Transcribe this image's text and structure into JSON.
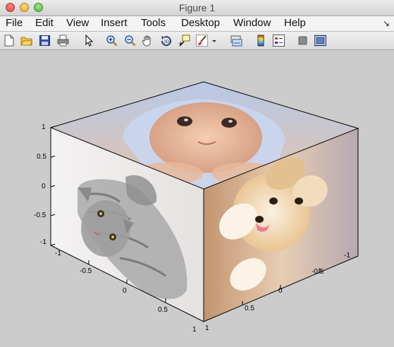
{
  "window": {
    "title": "Figure 1"
  },
  "menu": {
    "items": [
      "File",
      "Edit",
      "View",
      "Insert",
      "Tools",
      "Desktop",
      "Window",
      "Help"
    ]
  },
  "toolbar": {
    "tools": [
      "new-figure-icon",
      "open-file-icon",
      "save-icon",
      "print-icon",
      "edit-plot-arrow-icon",
      "zoom-in-icon",
      "zoom-out-icon",
      "pan-hand-icon",
      "rotate-3d-icon",
      "data-cursor-icon",
      "brush-icon",
      "brush-dropdown-icon",
      "link-plot-icon",
      "colorbar-icon",
      "legend-icon",
      "hide-plot-tools-icon",
      "show-plot-tools-icon"
    ]
  },
  "axes": {
    "z_ticks": [
      "1",
      "0.5",
      "0",
      "-0.5",
      "-1"
    ],
    "x_ticks": [
      "-1",
      "-0.5",
      "0",
      "0.5",
      "1"
    ],
    "y_ticks": [
      "-1",
      "-0.5",
      "0",
      "0.5",
      "1"
    ]
  },
  "faces": {
    "top": "baby-photo",
    "left": "kitten-photo",
    "right": "puppy-photo"
  },
  "colors": {
    "figure_background": "#cccccc",
    "menu_background": "#f4f4f4"
  }
}
